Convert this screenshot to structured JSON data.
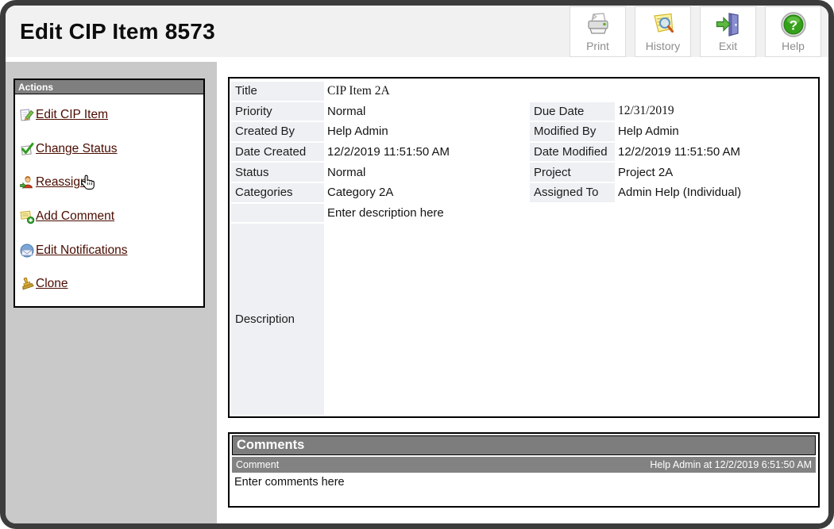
{
  "window": {
    "title": "Edit CIP Item 8573"
  },
  "toolbar": {
    "buttons": [
      {
        "label": "Print",
        "icon": "print-icon"
      },
      {
        "label": "History",
        "icon": "history-icon"
      },
      {
        "label": "Exit",
        "icon": "exit-icon"
      },
      {
        "label": "Help",
        "icon": "help-icon"
      }
    ]
  },
  "sidebar": {
    "header": "Actions",
    "items": [
      {
        "label": "Edit CIP Item",
        "icon": "edit-cip-item-icon"
      },
      {
        "label": "Change Status",
        "icon": "change-status-icon"
      },
      {
        "label": "Reassign",
        "icon": "reassign-icon"
      },
      {
        "label": "Add Comment",
        "icon": "add-comment-icon"
      },
      {
        "label": "Edit Notifications",
        "icon": "edit-notifications-icon"
      },
      {
        "label": "Clone",
        "icon": "clone-icon"
      }
    ],
    "cursor_icon": "hand-cursor-icon"
  },
  "details": {
    "left_rows": [
      {
        "label": "Title",
        "value": "CIP Item 2A"
      },
      {
        "label": "Priority",
        "value": "Normal"
      },
      {
        "label": "Created By",
        "value": "Help Admin"
      },
      {
        "label": "Date Created",
        "value": "12/2/2019 11:51:50 AM"
      },
      {
        "label": "Status",
        "value": "Normal"
      },
      {
        "label": "Categories",
        "value": "Category 2A"
      }
    ],
    "right_rows": [
      {
        "label": "Due Date",
        "value": "12/31/2019"
      },
      {
        "label": "Modified By",
        "value": "Help Admin"
      },
      {
        "label": "Date Modified",
        "value": "12/2/2019 11:51:50 AM"
      },
      {
        "label": "Project",
        "value": "Project 2A"
      },
      {
        "label": "Assigned To",
        "value": "Admin Help (Individual)"
      }
    ],
    "description_label": "Description",
    "description_placeholder": "Enter description here"
  },
  "comments": {
    "header": "Comments",
    "column_header": "Comment",
    "meta": "Help Admin at 12/2/2019 6:51:50 AM",
    "placeholder": "Enter comments here"
  },
  "colors": {
    "frame": "#3c3c3c",
    "header_bg": "#f1f1f1",
    "sidebar_bg": "#c9c9c9",
    "panel_header_bg": "#7f7f7f",
    "link": "#4a0c00",
    "label_cell_bg": "#eef0f3",
    "comment_row_bg": "#828282",
    "button_label": "#8d8d8d"
  }
}
